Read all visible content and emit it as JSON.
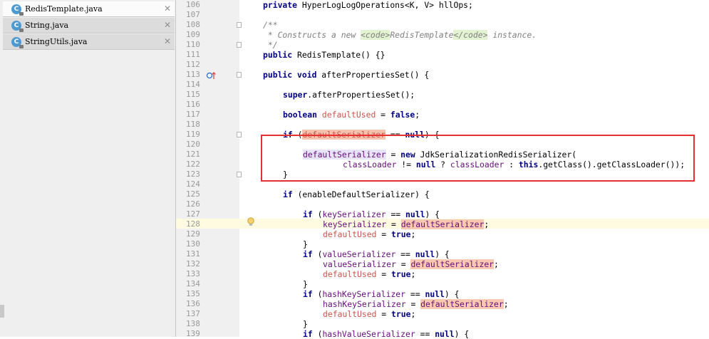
{
  "tabs": [
    {
      "label": "RedisTemplate.java",
      "icon_letter": "C",
      "close": "✕"
    },
    {
      "label": "String.java",
      "icon_letter": "C",
      "close": "✕"
    },
    {
      "label": "StringUtils.java",
      "icon_letter": "C",
      "close": "✕"
    }
  ],
  "lines": {
    "n106": "106",
    "n107": "107",
    "n108": "108",
    "n109": "109",
    "n110": "110",
    "n111": "111",
    "n112": "112",
    "n113": "113",
    "n114": "114",
    "n115": "115",
    "n116": "116",
    "n117": "117",
    "n118": "118",
    "n119": "119",
    "n120": "120",
    "n121": "121",
    "n122": "122",
    "n123": "123",
    "n124": "124",
    "n125": "125",
    "n126": "126",
    "n127": "127",
    "n128": "128",
    "n129": "129",
    "n130": "130",
    "n131": "131",
    "n132": "132",
    "n133": "133",
    "n134": "134",
    "n135": "135",
    "n136": "136",
    "n137": "137",
    "n138": "138",
    "n139": "139"
  },
  "code": {
    "kw_private": "private",
    "hll_type": " HyperLogLogOperations<K, V> hllOps;",
    "c_open": "/**",
    "c_constructs": " * Constructs a new ",
    "c_tag_open": "<code>",
    "c_redis": "RedisTemplate",
    "c_tag_close": "</code>",
    "c_instance": " instance.",
    "c_close": " */",
    "kw_public": "public",
    "ctor": " RedisTemplate() {}",
    "kw_void": "void",
    "after_props": " afterPropertiesSet() {",
    "kw_super": "super",
    "super_call": ".afterPropertiesSet();",
    "kw_boolean": "boolean",
    "default_used": "defaultUsed",
    "kw_false": "false",
    "kw_if": "if",
    "default_serializer": "defaultSerializer",
    "kw_null": "null",
    "kw_new": "new",
    "jdk_ser": " JdkSerializationRedisSerializer(",
    "class_loader": "classLoader",
    "kw_this": "this",
    "get_class_loader": ".getClass().getClassLoader());",
    "enable_default": " (enableDefaultSerializer) {",
    "key_serializer": "keySerializer",
    "value_serializer": "valueSerializer",
    "hash_key_serializer": "hashKeySerializer",
    "hash_value_serializer": "hashValueSerializer",
    "kw_true": "true",
    "brace_close": "}",
    "eq_null_open": " == ",
    "open_brace": ") {",
    "assign": " = ",
    "semicolon": ";",
    "neq_null": " != ",
    "ternary_q": " ? ",
    "ternary_c": " : ",
    "paren_open": " (",
    "eq_sign": " = "
  },
  "colors": {
    "keyword": "#000080",
    "field": "#660e7a",
    "comment": "#808080",
    "highlight_box": "#e63030"
  }
}
